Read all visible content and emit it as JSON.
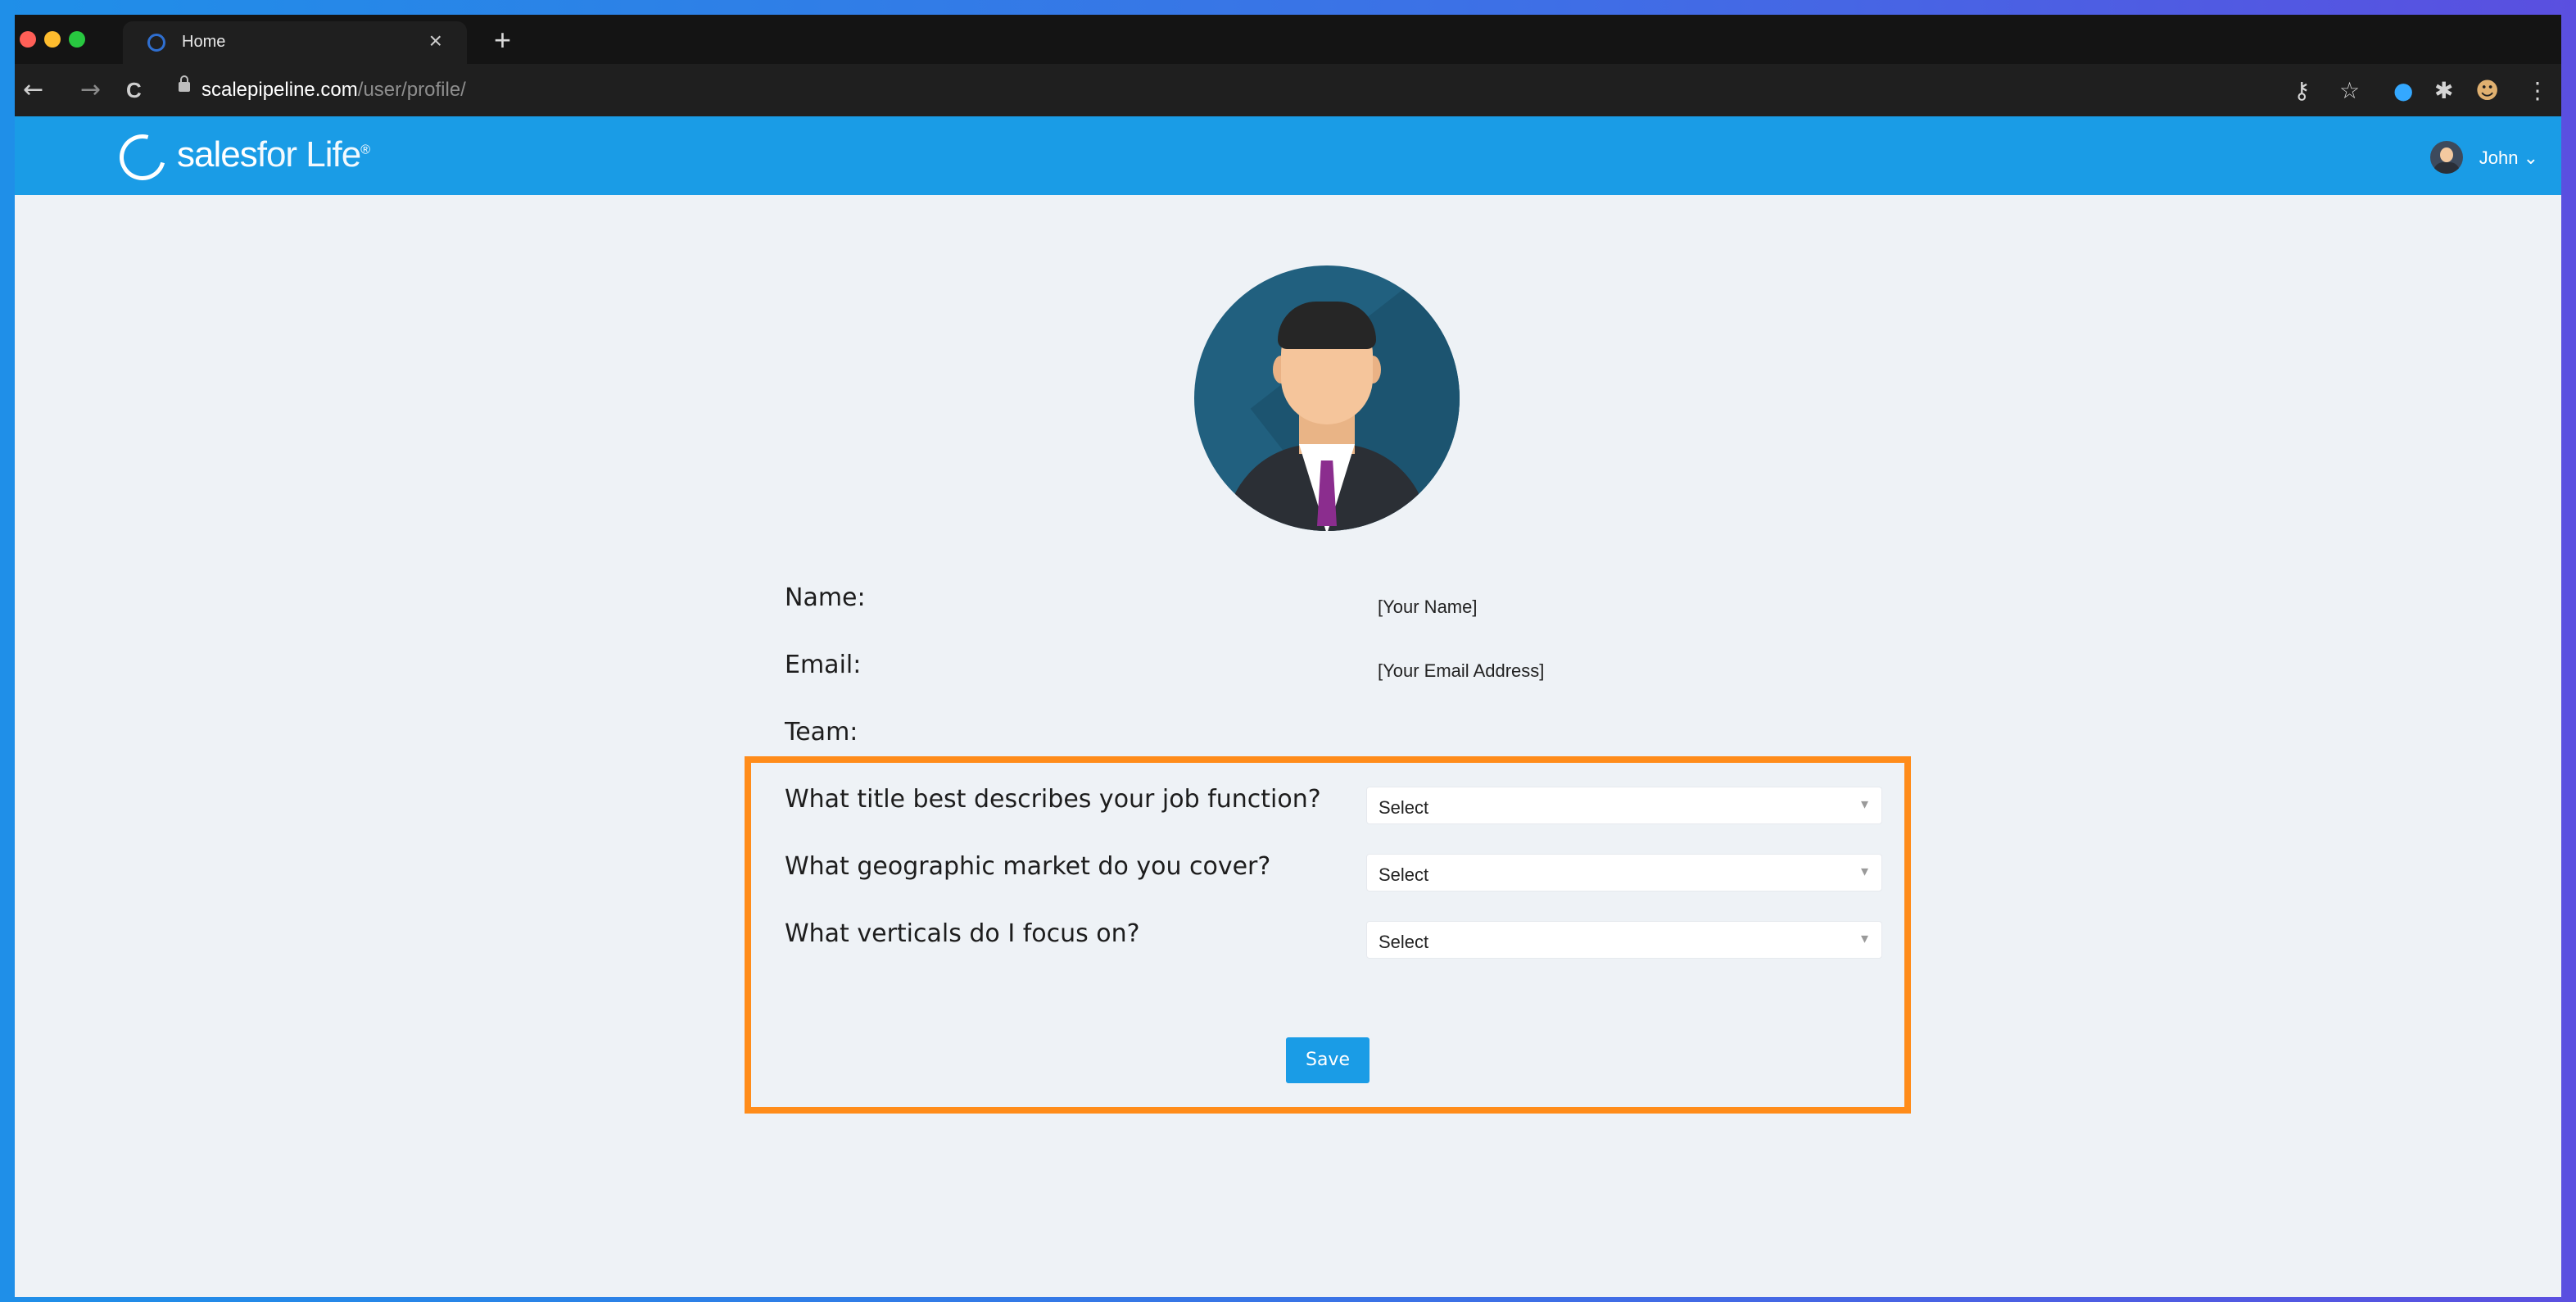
{
  "browser": {
    "tab_title": "Home",
    "tab_close": "×",
    "new_tab": "+",
    "url_host": "scalepipeline.com",
    "url_path": "/user/profile/",
    "nav_back": "←",
    "nav_forward": "→",
    "nav_reload": "C"
  },
  "app": {
    "brand_bold": "sales",
    "brand_light": "for Life",
    "brand_mark": "®",
    "user_name": "John",
    "user_chevron": "⌄"
  },
  "profile": {
    "name_label": "Name:",
    "name_value": "[Your Name]",
    "email_label": "Email:",
    "email_value": "[Your Email Address]",
    "team_label": "Team:"
  },
  "questions": [
    {
      "label": "What title best describes your job function?",
      "selected": "Select"
    },
    {
      "label": "What geographic market do you cover?",
      "selected": "Select"
    },
    {
      "label": "What verticals do I focus on?",
      "selected": "Select"
    }
  ],
  "actions": {
    "save_label": "Save"
  },
  "colors": {
    "header_blue": "#1a9ce6",
    "highlight_orange": "#ff8c1a",
    "page_bg": "#eef2f6"
  }
}
